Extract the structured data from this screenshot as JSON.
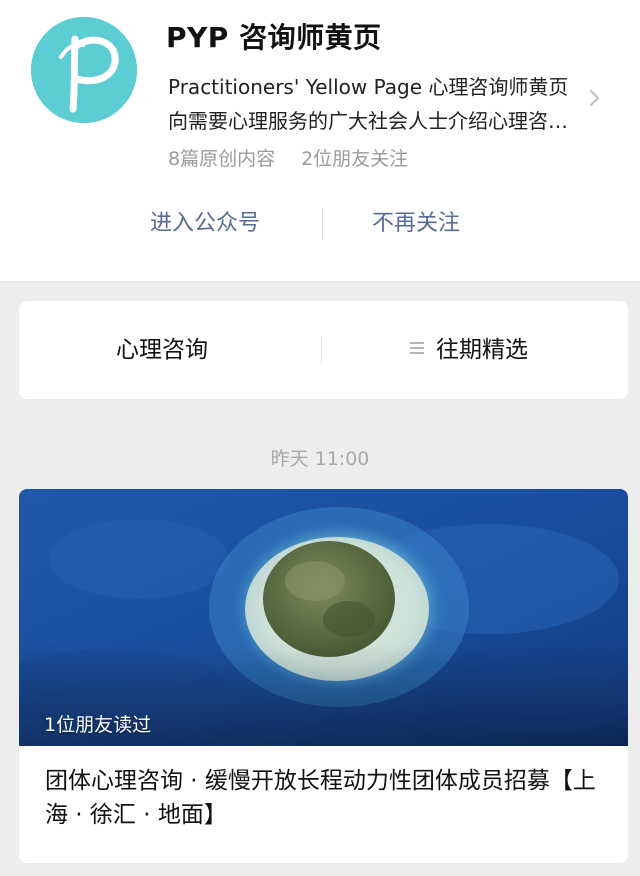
{
  "account": {
    "name": "PYP 咨询师黄页",
    "description": "Practitioners' Yellow Page 心理咨询师黄页　向需要心理服务的广大社会人士介绍心理咨询师",
    "stats": {
      "original_count": "8篇原创内容",
      "friends_following": "2位朋友关注"
    },
    "logo_letter": "p"
  },
  "actions": {
    "enter_label": "进入公众号",
    "unfollow_label": "不再关注"
  },
  "menu": {
    "items": [
      {
        "label": "心理咨询"
      },
      {
        "label": "往期精选"
      }
    ]
  },
  "feed": {
    "timestamp": "昨天 11:00",
    "article": {
      "reads": "1位朋友读过",
      "title": "团体心理咨询 · 缓慢开放长程动力性团体成员招募【上海 · 徐汇 · 地面】"
    }
  },
  "colors": {
    "logo_bg": "#5ccdd3",
    "link": "#576b95",
    "background": "#ededed"
  },
  "icons": {
    "chevron": "chevron-right-icon",
    "menu": "menu-lines-icon"
  }
}
